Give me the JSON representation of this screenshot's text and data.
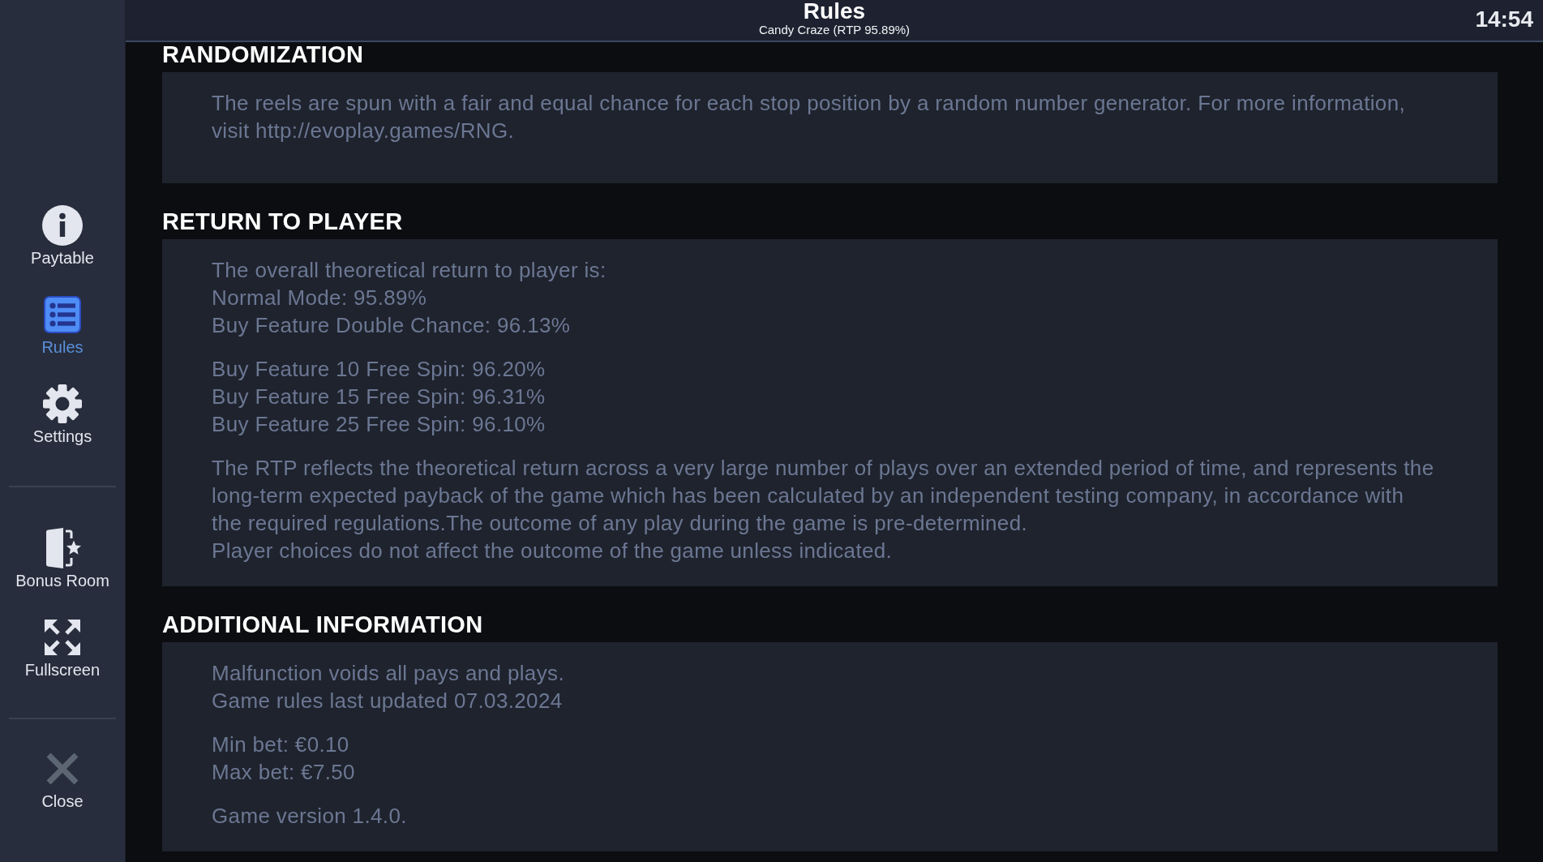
{
  "header": {
    "title": "Rules",
    "subtitle": "Candy Craze (RTP 95.89%)",
    "clock": "14:54"
  },
  "sidebar": {
    "groups": [
      {
        "items": [
          {
            "kind": "paytable",
            "label": "Paytable",
            "selected": false
          },
          {
            "kind": "rules",
            "label": "Rules",
            "selected": true
          },
          {
            "kind": "settings",
            "label": "Settings",
            "selected": false
          }
        ]
      },
      {
        "items": [
          {
            "kind": "bonus",
            "label": "Bonus Room",
            "selected": false
          },
          {
            "kind": "fullscreen",
            "label": "Fullscreen",
            "selected": false
          }
        ]
      },
      {
        "items": [
          {
            "kind": "close",
            "label": "Close",
            "selected": false
          }
        ]
      }
    ]
  },
  "sections": [
    {
      "heading": "RANDOMIZATION",
      "paragraphs": [
        {
          "lines": [
            "The reels are spun with a fair and equal chance for each stop position by a random number generator. For more information, visit http://evoplay.games/RNG."
          ]
        }
      ]
    },
    {
      "heading": "RETURN TO PLAYER",
      "paragraphs": [
        {
          "lines": [
            "The overall theoretical return to player is:",
            "Normal Mode: 95.89%",
            "Buy Feature Double Chance: 96.13%"
          ]
        },
        {
          "lines": [
            "Buy Feature 10 Free Spin: 96.20%",
            "Buy Feature 15 Free Spin: 96.31%",
            "Buy Feature 25 Free Spin: 96.10%"
          ]
        },
        {
          "lines": [
            "The RTP reflects the theoretical return across a very large number of plays over an extended period of time, and represents the long-term expected payback of the game which has been calculated by an independent testing company, in accordance with the required regulations.The outcome of any play during the game is pre-determined.",
            "Player choices do not affect the outcome of the game unless indicated."
          ]
        }
      ]
    },
    {
      "heading": "ADDITIONAL INFORMATION",
      "paragraphs": [
        {
          "lines": [
            "Malfunction voids all pays and plays.",
            "Game rules last updated 07.03.2024"
          ]
        },
        {
          "lines": [
            "Min bet: €0.10",
            "Max bet: €7.50"
          ]
        },
        {
          "lines": [
            "Game version 1.4.0."
          ]
        }
      ]
    }
  ]
}
